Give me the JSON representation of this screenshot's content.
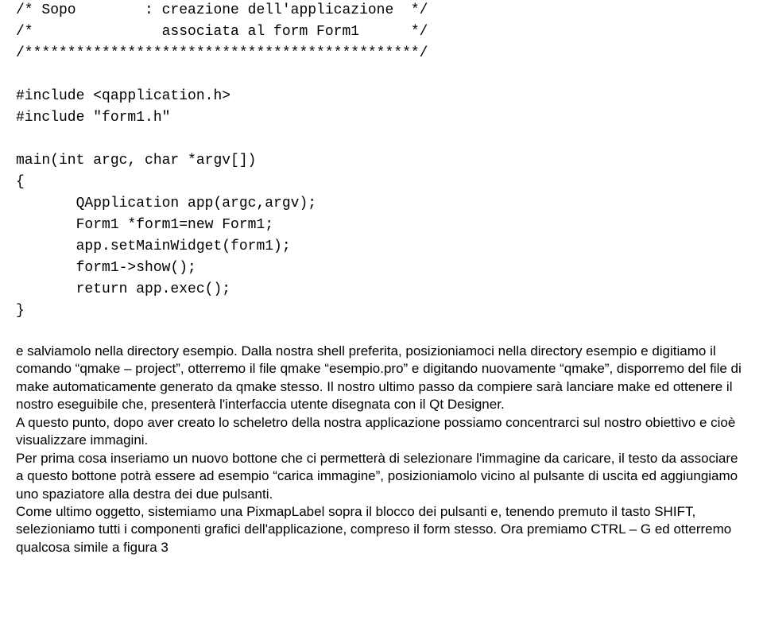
{
  "code": {
    "line1": "/* Sopo        : creazione dell'applicazione  */",
    "line2": "/*               associata al form Form1      */",
    "line3": "/**********************************************/",
    "line4": "",
    "line5": "#include <qapplication.h>",
    "line6": "#include \"form1.h\"",
    "line7": "",
    "line8": "main(int argc, char *argv[])",
    "line9": "{",
    "line10": "       QApplication app(argc,argv);",
    "line11": "       Form1 *form1=new Form1;",
    "line12": "       app.setMainWidget(form1);",
    "line13": "       form1->show();",
    "line14": "       return app.exec();",
    "line15": "}"
  },
  "prose": {
    "p1": "e salviamolo nella directory esempio. Dalla nostra shell preferita, posizioniamoci nella directory esempio e digitiamo il comando “qmake – project”, otterremo il file qmake “esempio.pro” e digitando nuovamente “qmake”, disporremo del file di make automaticamente generato da qmake stesso. Il nostro ultimo passo da compiere sarà lanciare make ed ottenere il nostro eseguibile che, presenterà l'interfaccia utente disegnata con il Qt Designer.",
    "p2": "A questo punto, dopo aver creato lo scheletro della nostra applicazione possiamo concentrarci sul nostro obiettivo e cioè visualizzare immagini.",
    "p3": "Per prima cosa inseriamo un nuovo bottone che ci permetterà di selezionare l'immagine da caricare, il testo da associare a questo bottone potrà essere ad esempio “carica immagine”, posizioniamolo vicino al pulsante di uscita ed aggiungiamo uno spaziatore alla destra dei due pulsanti.",
    "p4": "Come ultimo oggetto, sistemiamo una PixmapLabel sopra il blocco dei pulsanti e, tenendo premuto il tasto SHIFT, selezioniamo tutti i componenti grafici dell'applicazione, compreso il form stesso. Ora premiamo CTRL – G ed otterremo qualcosa simile a figura 3"
  }
}
